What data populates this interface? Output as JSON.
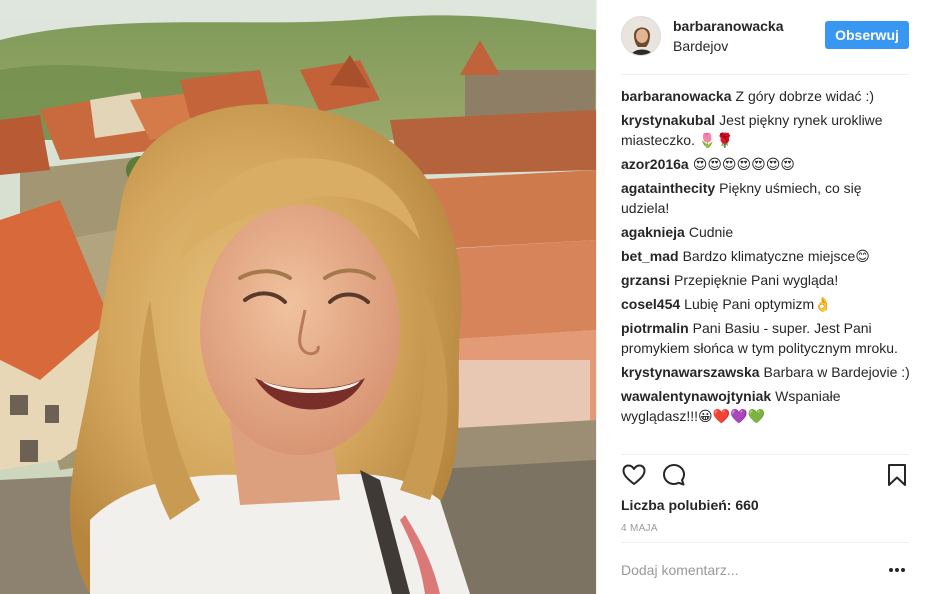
{
  "header": {
    "username": "barbaranowacka",
    "location": "Bardejov",
    "follow_label": "Obserwuj"
  },
  "comments": [
    {
      "user": "barbaranowacka",
      "text": "Z góry dobrze widać :)"
    },
    {
      "user": "krystynakubal",
      "text": "Jest piękny rynek urokliwe miasteczko. 🌷🌹"
    },
    {
      "user": "azor2016a",
      "text": "😍😍😍😍😍😍😍"
    },
    {
      "user": "agatainthecity",
      "text": "Piękny uśmiech, co się udziela!"
    },
    {
      "user": "agaknieja",
      "text": "Cudnie"
    },
    {
      "user": "bet_mad",
      "text": "Bardzo klimatyczne miejsce😊"
    },
    {
      "user": "grzansi",
      "text": "Przepięknie Pani wygląda!"
    },
    {
      "user": "cosel454",
      "text": "Lubię Pani optymizm👌"
    },
    {
      "user": "piotrmalin",
      "text": "Pani Basiu - super. Jest Pani promykiem słońca w tym politycznym mroku."
    },
    {
      "user": "krystynawarszawska",
      "text": "Barbara w Bardejovie :)"
    },
    {
      "user": "wawalentynawojtyniak",
      "text": "Wspaniałe wyglądasz!!!😀❤️💜💚"
    }
  ],
  "actions": {
    "like_icon": "heart-icon",
    "comment_icon": "speech-bubble-icon",
    "save_icon": "bookmark-icon"
  },
  "likes_text": "Liczba polubień: 660",
  "date_text": "4 MAJA",
  "add_comment_placeholder": "Dodaj komentarz...",
  "more_icon": "ellipsis-icon",
  "colors": {
    "follow_button": "#3897f0",
    "text": "#262626",
    "muted": "#999999",
    "divider": "#efefef"
  }
}
